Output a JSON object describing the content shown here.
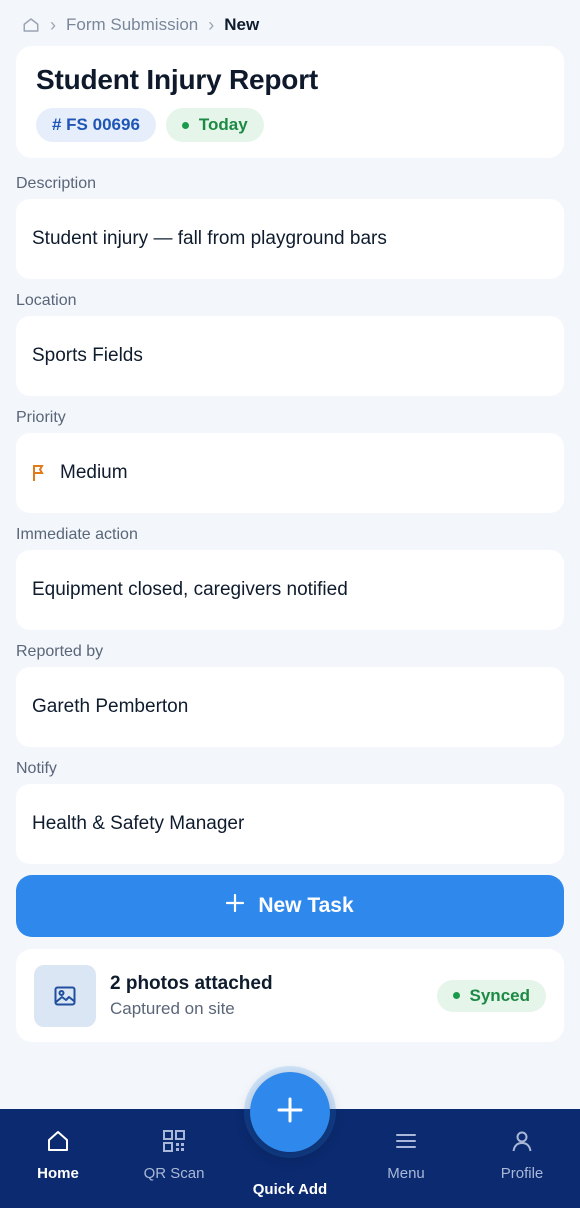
{
  "breadcrumb": {
    "home_icon": "home-icon",
    "parent": "Form Submission",
    "current": "New"
  },
  "header": {
    "title": "Student Injury Report",
    "id_chip": "# FS 00696",
    "date_chip": "Today"
  },
  "fields": {
    "description": {
      "label": "Description",
      "value": "Student injury — fall from playground bars"
    },
    "location": {
      "label": "Location",
      "value": "Sports Fields"
    },
    "priority": {
      "label": "Priority",
      "value": "Medium",
      "icon": "flag-icon"
    },
    "immediate_action": {
      "label": "Immediate action",
      "value": "Equipment closed, caregivers notified"
    },
    "reported_by": {
      "label": "Reported by",
      "value": "Gareth Pemberton"
    },
    "notify": {
      "label": "Notify",
      "value": "Health & Safety Manager"
    }
  },
  "new_task": {
    "label": "New Task",
    "icon": "plus-icon"
  },
  "photos": {
    "title": "2 photos attached",
    "subtitle": "Captured on site",
    "status": "Synced",
    "icon": "image-icon"
  },
  "nav": {
    "home": "Home",
    "qr_scan": "QR Scan",
    "quick_add": "Quick Add",
    "menu": "Menu",
    "profile": "Profile"
  },
  "colors": {
    "accent": "#2f88ec",
    "nav_bg": "#0b2a6f",
    "success": "#1c8a45",
    "priority_medium": "#e07b1a"
  }
}
